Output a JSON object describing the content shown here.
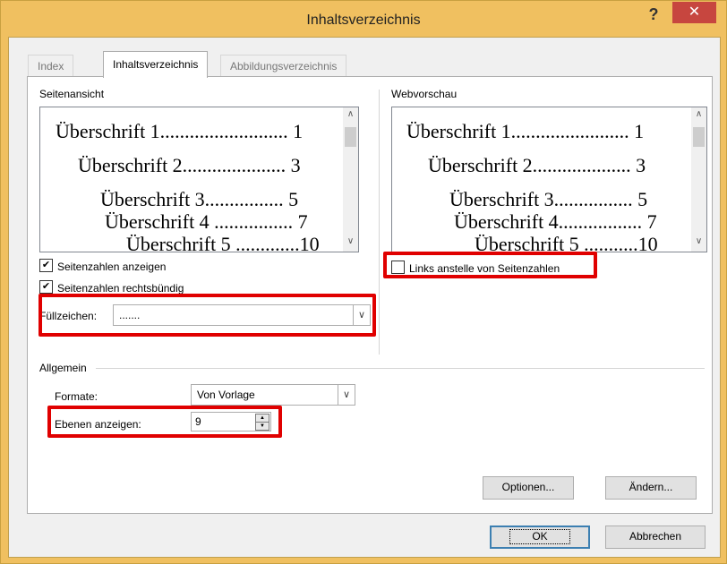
{
  "window": {
    "title": "Inhaltsverzeichnis",
    "help": "?",
    "close": "✕"
  },
  "tabs": [
    {
      "label": "Index",
      "active": false
    },
    {
      "label": "Inhaltsverzeichnis",
      "active": true
    },
    {
      "label": "Abbildungsverzeichnis",
      "active": false
    }
  ],
  "print_preview": {
    "label": "Seitenansicht",
    "lines": [
      "Überschrift 1.......................... 1",
      "Überschrift 2..................... 3",
      "Überschrift 3................ 5",
      "Überschrift 4 ................ 7",
      "Überschrift 5 .............10"
    ]
  },
  "web_preview": {
    "label": "Webvorschau",
    "lines": [
      "Überschrift 1........................ 1",
      "Überschrift 2.................... 3",
      "Überschrift 3................ 5",
      "Überschrift 4................. 7",
      "Überschrift 5 ...........10"
    ]
  },
  "options": {
    "show_page_numbers": {
      "label": "Seitenzahlen anzeigen",
      "checked": true
    },
    "right_align": {
      "label": "Seitenzahlen rechtsbündig",
      "checked": true
    },
    "tab_leader": {
      "label": "Füllzeichen:",
      "value": "......."
    },
    "use_hyperlinks": {
      "label": "Links anstelle von Seitenzahlen",
      "checked": false
    }
  },
  "general": {
    "label": "Allgemein",
    "formats": {
      "label": "Formate:",
      "value": "Von Vorlage"
    },
    "levels": {
      "label": "Ebenen anzeigen:",
      "value": "9"
    }
  },
  "buttons": {
    "options": "Optionen...",
    "modify": "Ändern...",
    "ok": "OK",
    "cancel": "Abbrechen"
  },
  "icons": {
    "check": "✔",
    "chevron_down": "∨",
    "chevron_up": "∧",
    "spin_up": "▲",
    "spin_down": "▼"
  },
  "colors": {
    "highlight": "#e00000",
    "titlebar": "#f0c060",
    "close": "#c7463f"
  }
}
